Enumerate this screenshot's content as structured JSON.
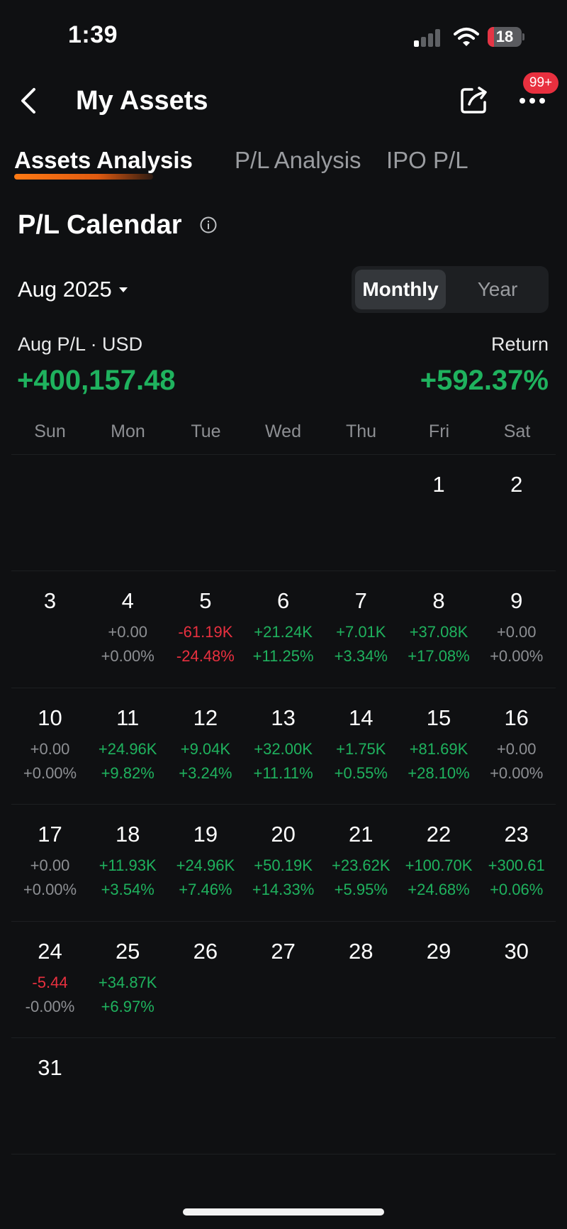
{
  "status_bar": {
    "time": "1:39",
    "battery": "18",
    "battery_level": 0.18
  },
  "nav": {
    "title": "My Assets",
    "badge": "99+"
  },
  "tabs": [
    {
      "label": "Assets Analysis",
      "active": true
    },
    {
      "label": "P/L Analysis",
      "active": false
    },
    {
      "label": "IPO P/L",
      "active": false
    }
  ],
  "section": {
    "title": "P/L Calendar"
  },
  "period": {
    "month": "Aug 2025",
    "modes": [
      "Monthly",
      "Year"
    ],
    "selected": "Monthly"
  },
  "summary": {
    "pl_label": "Aug P/L · USD",
    "pl_value": "+400,157.48",
    "return_label": "Return",
    "return_value": "+592.37%"
  },
  "weekdays": [
    "Sun",
    "Mon",
    "Tue",
    "Wed",
    "Thu",
    "Fri",
    "Sat"
  ],
  "calendar": {
    "first_weekday": 5,
    "days": [
      {
        "day": "1"
      },
      {
        "day": "2"
      },
      {
        "day": "3"
      },
      {
        "day": "4",
        "amount": "+0.00",
        "percent": "+0.00%",
        "tone": "zero"
      },
      {
        "day": "5",
        "amount": "-61.19K",
        "percent": "-24.48%",
        "tone": "neg"
      },
      {
        "day": "6",
        "amount": "+21.24K",
        "percent": "+11.25%",
        "tone": "pos"
      },
      {
        "day": "7",
        "amount": "+7.01K",
        "percent": "+3.34%",
        "tone": "pos"
      },
      {
        "day": "8",
        "amount": "+37.08K",
        "percent": "+17.08%",
        "tone": "pos"
      },
      {
        "day": "9",
        "amount": "+0.00",
        "percent": "+0.00%",
        "tone": "zero"
      },
      {
        "day": "10",
        "amount": "+0.00",
        "percent": "+0.00%",
        "tone": "zero"
      },
      {
        "day": "11",
        "amount": "+24.96K",
        "percent": "+9.82%",
        "tone": "pos"
      },
      {
        "day": "12",
        "amount": "+9.04K",
        "percent": "+3.24%",
        "tone": "pos"
      },
      {
        "day": "13",
        "amount": "+32.00K",
        "percent": "+11.11%",
        "tone": "pos"
      },
      {
        "day": "14",
        "amount": "+1.75K",
        "percent": "+0.55%",
        "tone": "pos"
      },
      {
        "day": "15",
        "amount": "+81.69K",
        "percent": "+28.10%",
        "tone": "pos"
      },
      {
        "day": "16",
        "amount": "+0.00",
        "percent": "+0.00%",
        "tone": "zero"
      },
      {
        "day": "17",
        "amount": "+0.00",
        "percent": "+0.00%",
        "tone": "zero"
      },
      {
        "day": "18",
        "amount": "+11.93K",
        "percent": "+3.54%",
        "tone": "pos"
      },
      {
        "day": "19",
        "amount": "+24.96K",
        "percent": "+7.46%",
        "tone": "pos"
      },
      {
        "day": "20",
        "amount": "+50.19K",
        "percent": "+14.33%",
        "tone": "pos"
      },
      {
        "day": "21",
        "amount": "+23.62K",
        "percent": "+5.95%",
        "tone": "pos"
      },
      {
        "day": "22",
        "amount": "+100.70K",
        "percent": "+24.68%",
        "tone": "pos"
      },
      {
        "day": "23",
        "amount": "+300.61",
        "percent": "+0.06%",
        "tone": "pos"
      },
      {
        "day": "24",
        "amount": "-5.44",
        "percent": "-0.00%",
        "tone": "neg",
        "percent_tone": "zero"
      },
      {
        "day": "25",
        "amount": "+34.87K",
        "percent": "+6.97%",
        "tone": "pos"
      },
      {
        "day": "26"
      },
      {
        "day": "27"
      },
      {
        "day": "28"
      },
      {
        "day": "29"
      },
      {
        "day": "30"
      },
      {
        "day": "31"
      }
    ]
  },
  "colors": {
    "positive": "#1fb25e",
    "negative": "#e8303f",
    "neutral": "#8d8f93",
    "accent": "#ff7a14"
  },
  "icons": [
    "back-arrow-icon",
    "share-icon",
    "more-icon",
    "info-icon",
    "caret-down-icon",
    "wifi-icon",
    "signal-icon",
    "battery-icon"
  ]
}
